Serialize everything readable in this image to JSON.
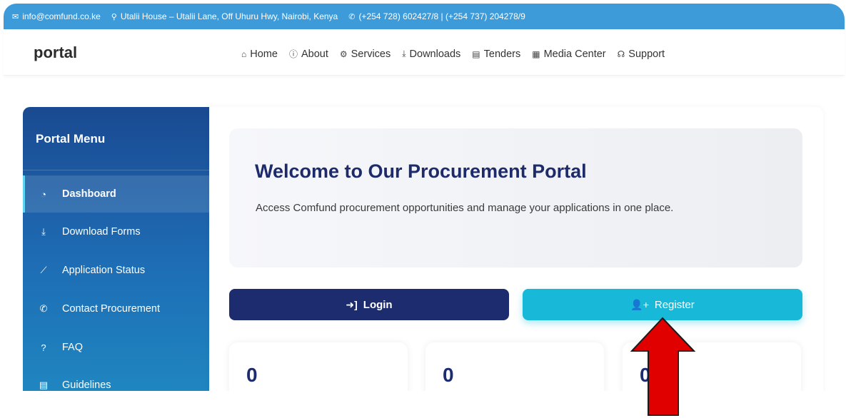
{
  "topbar": {
    "email": "info@comfund.co.ke",
    "address": "Utalii House – Utalii Lane, Off Uhuru Hwy, Nairobi, Kenya",
    "phone": "(+254 728) 602427/8 | (+254 737) 204278/9",
    "icons": {
      "email": "envelope-icon",
      "address": "map-pin-icon",
      "phone": "phone-icon"
    }
  },
  "header": {
    "brand": "portal",
    "nav": [
      {
        "label": "Home",
        "icon": "home-icon"
      },
      {
        "label": "About",
        "icon": "info-icon"
      },
      {
        "label": "Services",
        "icon": "cogs-icon"
      },
      {
        "label": "Downloads",
        "icon": "download-icon"
      },
      {
        "label": "Tenders",
        "icon": "file-icon"
      },
      {
        "label": "Media Center",
        "icon": "newspaper-icon"
      },
      {
        "label": "Support",
        "icon": "headset-icon"
      }
    ]
  },
  "sidebar": {
    "title": "Portal Menu",
    "items": [
      {
        "label": "Dashboard",
        "icon": "tachometer-icon",
        "active": true
      },
      {
        "label": "Download Forms",
        "icon": "download-icon"
      },
      {
        "label": "Application Status",
        "icon": "chart-line-icon"
      },
      {
        "label": "Contact Procurement",
        "icon": "phone-icon"
      },
      {
        "label": "FAQ",
        "icon": "question-circle-icon"
      },
      {
        "label": "Guidelines",
        "icon": "file-alt-icon"
      }
    ]
  },
  "main": {
    "hero": {
      "title": "Welcome to Our Procurement Portal",
      "subtitle": "Access Comfund procurement opportunities and manage your applications in one place."
    },
    "buttons": {
      "login": "Login",
      "register": "Register"
    },
    "stats": [
      "0",
      "0",
      "0"
    ]
  },
  "colors": {
    "topbar": "#3d9bd9",
    "sidebar_top": "#1a4a91",
    "sidebar_bottom": "#1f86c0",
    "login_button": "#1d2c6e",
    "register_button": "#17b8d8",
    "arrow": "#e00000"
  }
}
